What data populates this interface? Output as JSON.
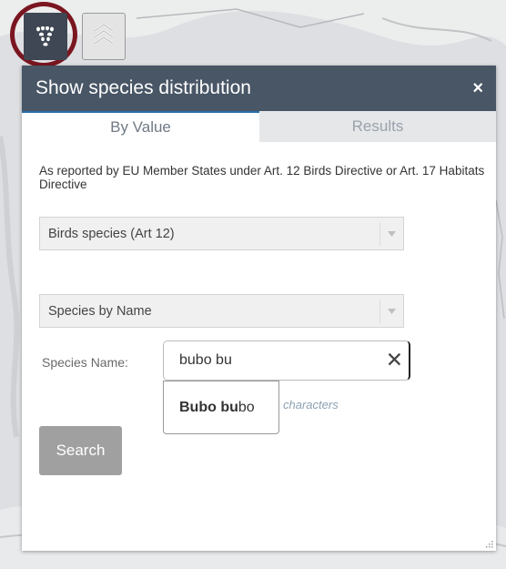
{
  "toolbar": {
    "species_icon": "paw-prints-icon",
    "layers_icon": "layers-icon",
    "highlight_color": "#7a1620"
  },
  "panel": {
    "title": "Show species distribution",
    "close_label": "×",
    "header_color": "#485666"
  },
  "tabs": [
    {
      "label": "By Value",
      "active": true
    },
    {
      "label": "Results",
      "active": false
    }
  ],
  "form": {
    "description": "As reported by EU Member States under Art. 12 Birds Directive or Art. 17 Habitats Directive",
    "group_select": "Birds species (Art 12)",
    "mode_select": "Species by Name",
    "species_label": "Species Name:",
    "species_value": "bubo bu",
    "clear_label": "✕",
    "suggestion_match": "Bubo bu",
    "suggestion_rest": "bo",
    "hint": "characters",
    "search_label": "Search"
  }
}
